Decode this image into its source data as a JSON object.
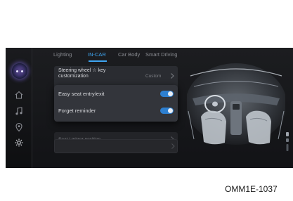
{
  "tabs": [
    {
      "label": "Lighting",
      "active": false
    },
    {
      "label": "IN-CAR",
      "active": true
    },
    {
      "label": "Car Body",
      "active": false
    },
    {
      "label": "Smart Driving",
      "active": false
    }
  ],
  "rows": {
    "steering": {
      "label": "Steering wheel ☆ key customization",
      "value": "Custom"
    },
    "easy_seat": {
      "label": "Easy seat entry/exit",
      "enabled": true
    },
    "forget_reminder": {
      "label": "Forget reminder",
      "enabled": true
    },
    "seat_mirror": {
      "label": "Seat / mirror position"
    }
  },
  "rail_icons": [
    "assistant-avatar",
    "home-icon",
    "music-icon",
    "navigation-icon",
    "settings-icon"
  ],
  "colors": {
    "accent": "#3fa6f2",
    "toggle_on": "#2d7fd0",
    "screen_bg": "#17181b"
  },
  "figure_code": "OMM1E-1037"
}
